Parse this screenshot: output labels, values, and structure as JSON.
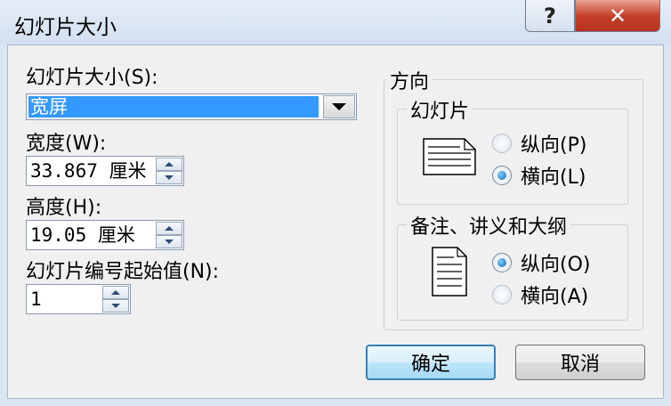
{
  "window": {
    "title": "幻灯片大小",
    "help_label": "?",
    "close_label": "✕"
  },
  "slide_size": {
    "label": "幻灯片大小(S):",
    "selected": "宽屏"
  },
  "width": {
    "label": "宽度(W):",
    "value": "33.867 厘米"
  },
  "height": {
    "label": "高度(H):",
    "value": "19.05 厘米"
  },
  "start_number": {
    "label": "幻灯片编号起始值(N):",
    "value": "1"
  },
  "orientation": {
    "label": "方向",
    "slides": {
      "label": "幻灯片",
      "options": [
        {
          "label": "纵向(P)",
          "selected": false
        },
        {
          "label": "横向(L)",
          "selected": true
        }
      ]
    },
    "notes": {
      "label": "备注、讲义和大纲",
      "options": [
        {
          "label": "纵向(O)",
          "selected": true
        },
        {
          "label": "横向(A)",
          "selected": false
        }
      ]
    }
  },
  "buttons": {
    "ok": "确定",
    "cancel": "取消"
  }
}
